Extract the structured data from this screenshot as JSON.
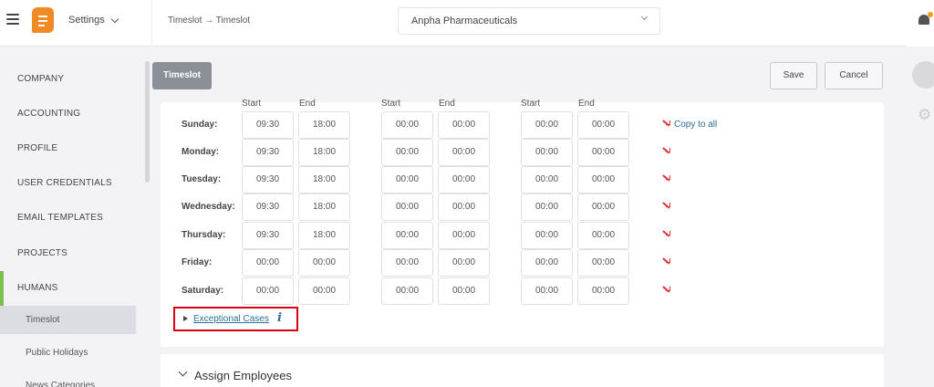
{
  "header": {
    "app_title": "Settings",
    "breadcrumb": "Timeslot → Timeslot",
    "company": "Anpha Pharmaceuticals",
    "accent": "#f08a24"
  },
  "sidebar": {
    "items": [
      "COMPANY",
      "ACCOUNTING",
      "PROFILE",
      "USER CREDENTIALS",
      "EMAIL TEMPLATES",
      "PROJECTS",
      "HUMANS"
    ],
    "subitems": [
      "Timeslot",
      "Public Holidays",
      "News Categories"
    ]
  },
  "toolbar": {
    "tab_label": "Timeslot",
    "save_label": "Save",
    "cancel_label": "Cancel"
  },
  "schedule": {
    "col_start": "Start",
    "col_end": "End",
    "copy_label": "Copy to all",
    "days": [
      {
        "name": "Sunday:",
        "slots": [
          "09:30",
          "18:00",
          "00:00",
          "00:00",
          "00:00",
          "00:00"
        ]
      },
      {
        "name": "Monday:",
        "slots": [
          "09:30",
          "18:00",
          "00:00",
          "00:00",
          "00:00",
          "00:00"
        ]
      },
      {
        "name": "Tuesday:",
        "slots": [
          "09:30",
          "18:00",
          "00:00",
          "00:00",
          "00:00",
          "00:00"
        ]
      },
      {
        "name": "Wednesday:",
        "slots": [
          "09:30",
          "18:00",
          "00:00",
          "00:00",
          "00:00",
          "00:00"
        ]
      },
      {
        "name": "Thursday:",
        "slots": [
          "09:30",
          "18:00",
          "00:00",
          "00:00",
          "00:00",
          "00:00"
        ]
      },
      {
        "name": "Friday:",
        "slots": [
          "00:00",
          "00:00",
          "00:00",
          "00:00",
          "00:00",
          "00:00"
        ]
      },
      {
        "name": "Saturday:",
        "slots": [
          "00:00",
          "00:00",
          "00:00",
          "00:00",
          "00:00",
          "00:00"
        ]
      }
    ],
    "exceptional_label": "Exceptional Cases",
    "info_glyph": "i"
  },
  "assign": {
    "title": "Assign Employees"
  }
}
